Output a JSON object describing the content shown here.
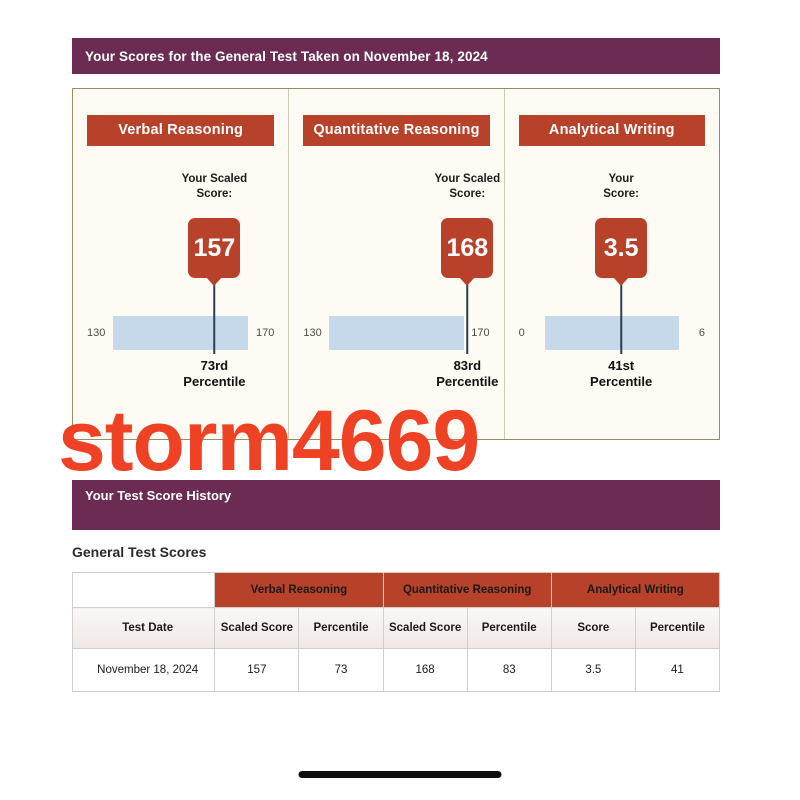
{
  "scores_section": {
    "header": "Your Scores for the General Test Taken on November 18, 2024",
    "panels": [
      {
        "title": "Verbal Reasoning",
        "score_caption": "Your Scaled\nScore:",
        "score": "157",
        "range_min": "130",
        "range_max": "170",
        "percentile": "73rd\nPercentile",
        "marker_percent": 68
      },
      {
        "title": "Quantitative Reasoning",
        "score_caption": "Your Scaled\nScore:",
        "score": "168",
        "range_min": "130",
        "range_max": "170",
        "percentile": "83rd\nPercentile",
        "marker_percent": 93
      },
      {
        "title": "Analytical Writing",
        "score_caption": "Your\nScore:",
        "score": "3.5",
        "range_min": "0",
        "range_max": "6",
        "percentile": "41st\nPercentile",
        "marker_percent": 57
      }
    ]
  },
  "history_section": {
    "header": "Your Test Score History",
    "title": "General Test Scores",
    "table": {
      "group_headers": [
        "Verbal Reasoning",
        "Quantitative Reasoning",
        "Analytical Writing"
      ],
      "sub_headers": [
        "Test Date",
        "Scaled Score",
        "Percentile",
        "Scaled Score",
        "Percentile",
        "Score",
        "Percentile"
      ],
      "rows": [
        [
          "November 18, 2024",
          "157",
          "73",
          "168",
          "83",
          "3.5",
          "41"
        ]
      ]
    }
  },
  "watermark": {
    "text": "storm4669"
  },
  "colors": {
    "purple": "#6b2b52",
    "red": "#b8412a",
    "bar_blue": "#c6d9ea",
    "card_bg": "#fdfbf4",
    "card_border": "#9a8d5e",
    "watermark": "#ef4123"
  }
}
